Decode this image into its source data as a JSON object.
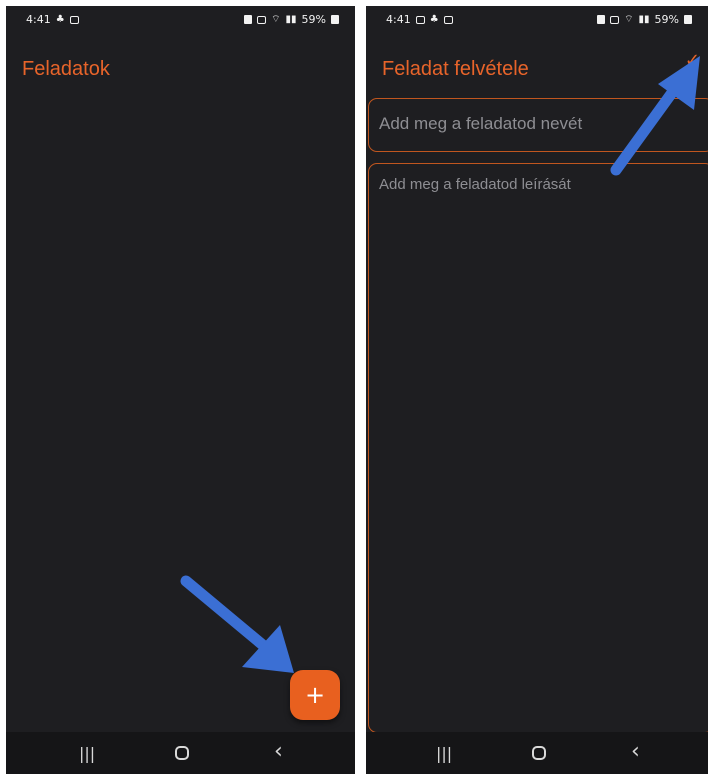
{
  "left": {
    "status": {
      "time": "4:41",
      "battery": "59%"
    },
    "title": "Feladatok",
    "fab_label": "+",
    "nav": {
      "recents": "|||",
      "back": "‹"
    }
  },
  "right": {
    "status": {
      "time": "4:41",
      "battery": "59%"
    },
    "title": "Feladat felvétele",
    "confirm_label": "✓",
    "name_placeholder": "Add meg a feladatod nevét",
    "description_placeholder": "Add meg a feladatod leírását",
    "nav": {
      "recents": "|||",
      "back": "‹"
    }
  },
  "colors": {
    "accent": "#e8642a",
    "background": "#1e1e21",
    "annotation_arrow": "#3b6fd4"
  }
}
